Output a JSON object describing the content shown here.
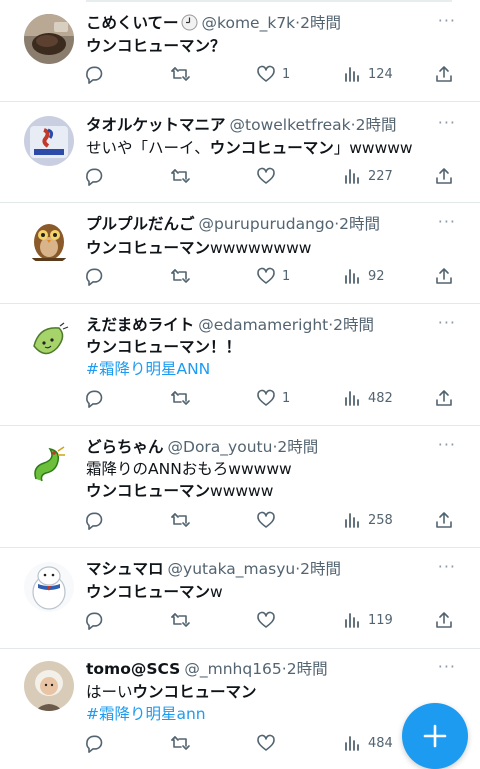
{
  "tweets": [
    {
      "name": "こめくいてー",
      "handle": "@kome_k7k",
      "time": "2時間",
      "lines": [
        {
          "parts": [
            {
              "t": "ウンコヒューマン？",
              "b": true
            }
          ]
        }
      ],
      "replies": "",
      "retweets": "",
      "likes": "1",
      "views": "124",
      "avatar": "food"
    },
    {
      "name": "タオルケットマニア",
      "handle": "@towelketfreak",
      "time": "2時間",
      "lines": [
        {
          "parts": [
            {
              "t": "せいや「ハーイ、"
            },
            {
              "t": "ウンコヒューマン",
              "b": true
            },
            {
              "t": "」wwwww"
            }
          ]
        }
      ],
      "replies": "",
      "retweets": "",
      "likes": "",
      "views": "227",
      "avatar": "rohto"
    },
    {
      "name": "プルプルだんご",
      "handle": "@purupurudango",
      "time": "2時間",
      "lines": [
        {
          "parts": [
            {
              "t": "ウンコヒューマン",
              "b": true
            },
            {
              "t": "wwwwwwww"
            }
          ]
        }
      ],
      "replies": "",
      "retweets": "",
      "likes": "1",
      "views": "92",
      "avatar": "owl"
    },
    {
      "name": "えだまめライト",
      "handle": "@edamameright",
      "time": "2時間",
      "lines": [
        {
          "parts": [
            {
              "t": "ウンコヒューマン！！",
              "b": true
            }
          ]
        },
        {
          "parts": [
            {
              "t": "#霜降り明星ANN",
              "h": true
            }
          ]
        }
      ],
      "replies": "",
      "retweets": "",
      "likes": "1",
      "views": "482",
      "avatar": "edamame"
    },
    {
      "name": "どらちゃん",
      "handle": "@Dora_youtu",
      "time": "2時間",
      "lines": [
        {
          "parts": [
            {
              "t": "霜降りのANNおもろwwwww"
            }
          ]
        },
        {
          "parts": [
            {
              "t": "ウンコヒューマン",
              "b": true
            },
            {
              "t": "wwwww"
            }
          ]
        }
      ],
      "replies": "",
      "retweets": "",
      "likes": "",
      "views": "258",
      "avatar": "dragon"
    },
    {
      "name": "マシュマロ",
      "handle": "@yutaka_masyu",
      "time": "2時間",
      "lines": [
        {
          "parts": [
            {
              "t": "ウンコヒューマン",
              "b": true
            },
            {
              "t": "w"
            }
          ]
        }
      ],
      "replies": "",
      "retweets": "",
      "likes": "",
      "views": "119",
      "avatar": "marshmallow"
    },
    {
      "name": "tomo@SCS",
      "handle": "@_mnhq165",
      "time": "2時間",
      "lines": [
        {
          "parts": [
            {
              "t": "はーい"
            },
            {
              "t": "ウンコヒューマン",
              "b": true
            }
          ]
        },
        {
          "parts": [
            {
              "t": "#霜降り明星ann",
              "h": true
            }
          ]
        }
      ],
      "replies": "",
      "retweets": "",
      "likes": "",
      "views": "484",
      "avatar": "person"
    }
  ],
  "more_label": "···",
  "colors": {
    "accent": "#1d9bf0",
    "muted": "#536471"
  },
  "fab": {
    "icon": "plus-icon"
  }
}
